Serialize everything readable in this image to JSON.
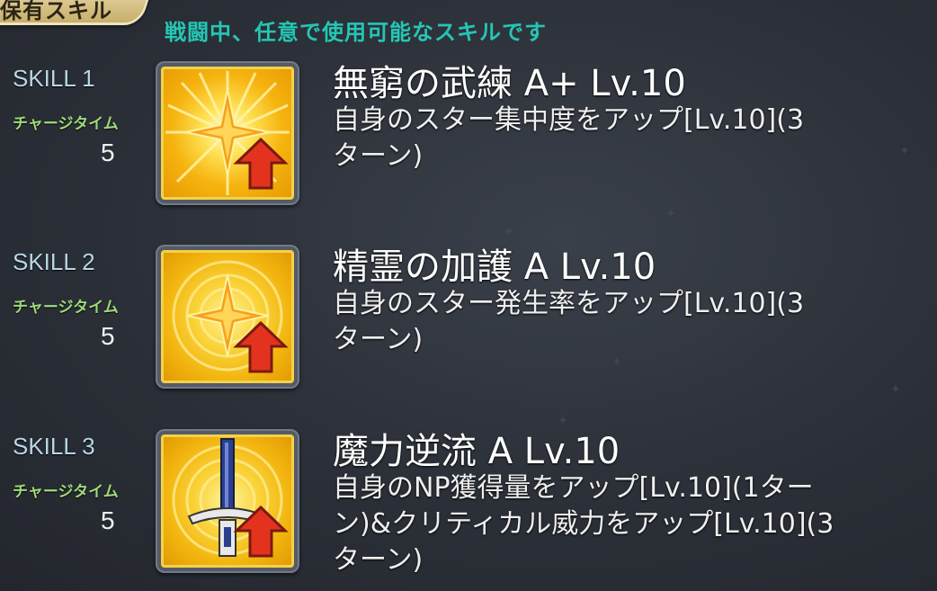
{
  "header": {
    "tab_label": "保有スキル",
    "subtitle": "戦闘中、任意で使用可能なスキルです"
  },
  "skills": [
    {
      "slot_label": "SKILL 1",
      "charge_label": "チャージタイム",
      "charge_value": "5",
      "title": "無窮の武練 A+ Lv.10",
      "desc_line1": "自身のスター集中度をアップ[Lv.10](3",
      "desc_line2": "ターン)",
      "desc_line3": "",
      "icon": "star-burst-up-arrow-icon"
    },
    {
      "slot_label": "SKILL 2",
      "charge_label": "チャージタイム",
      "charge_value": "5",
      "title": "精霊の加護 A Lv.10",
      "desc_line1": "自身のスター発生率をアップ[Lv.10](3",
      "desc_line2": "ターン)",
      "desc_line3": "",
      "icon": "star-circle-up-arrow-icon"
    },
    {
      "slot_label": "SKILL 3",
      "charge_label": "チャージタイム",
      "charge_value": "5",
      "title": "魔力逆流 A Lv.10",
      "desc_line1": "自身のNP獲得量をアップ[Lv.10](1ター",
      "desc_line2": "ン)&クリティカル威力をアップ[Lv.10](3",
      "desc_line3": "ターン)",
      "icon": "sword-up-arrow-icon"
    }
  ],
  "colors": {
    "accent_teal": "#24c7b4",
    "charge_green": "#9edb7a",
    "skill_label_blue": "#b8d7e6",
    "icon_gold": "#f3d24a",
    "arrow_red": "#e3331f"
  }
}
